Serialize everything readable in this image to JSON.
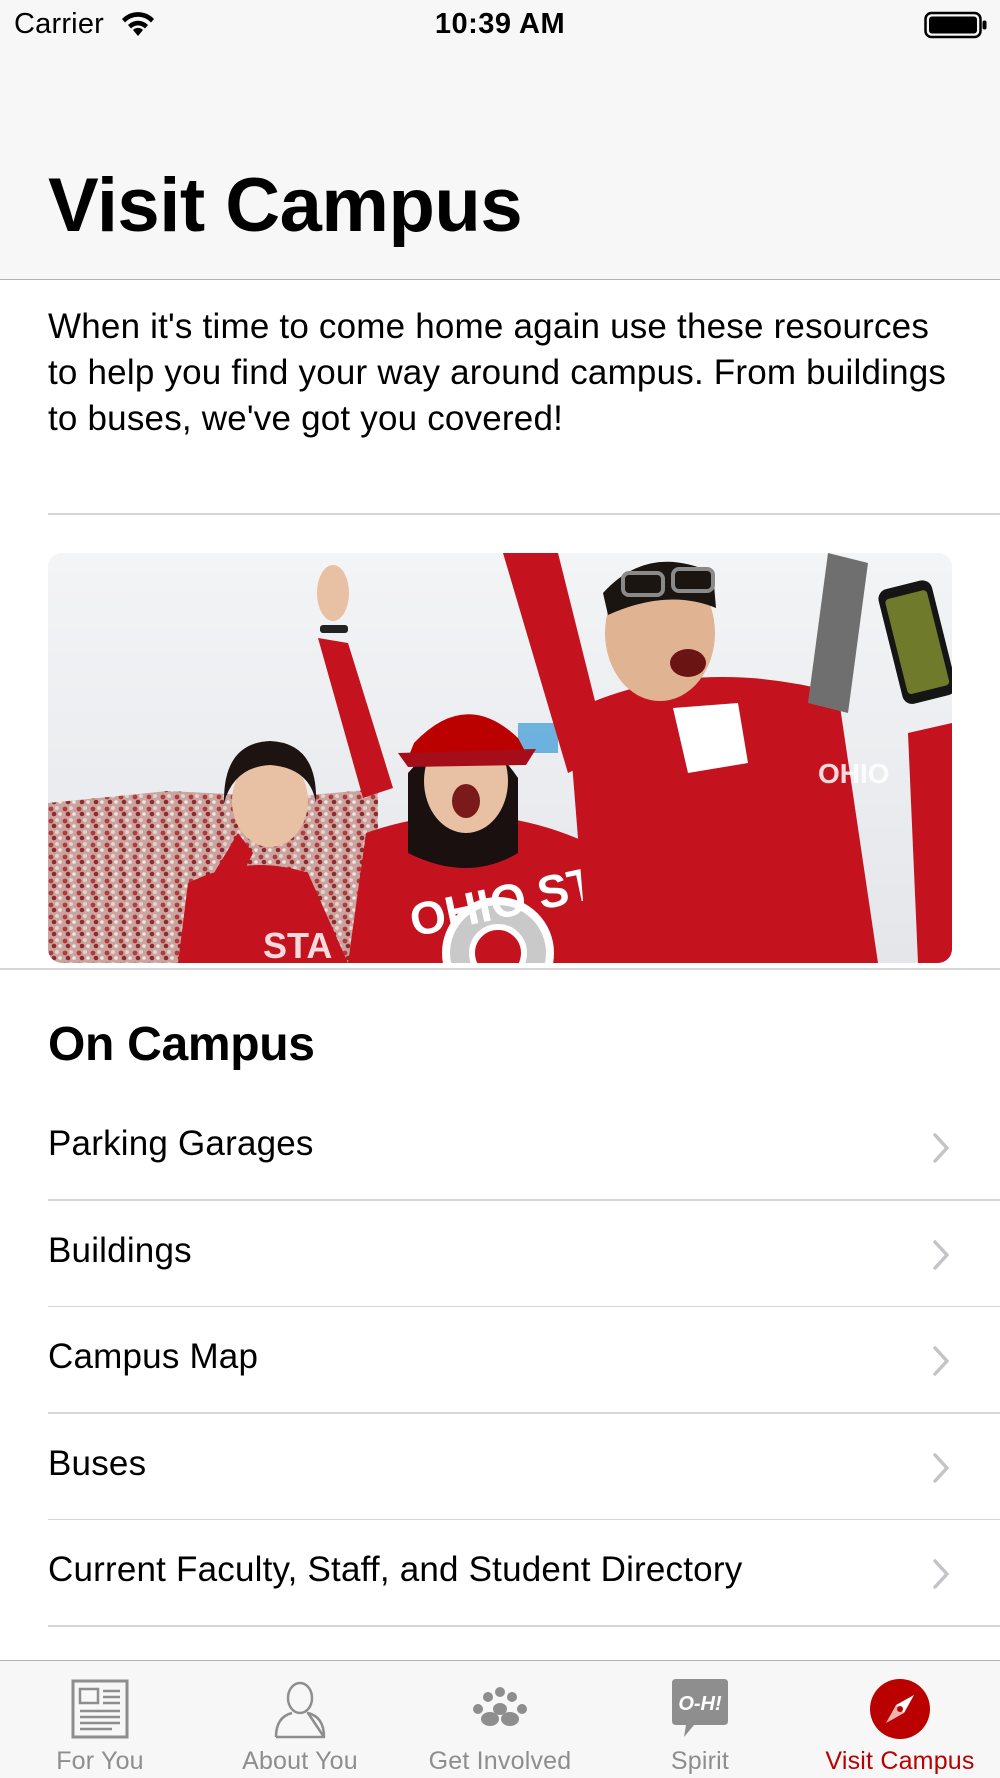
{
  "status_bar": {
    "carrier": "Carrier",
    "time": "10:39 AM"
  },
  "header": {
    "title": "Visit Campus"
  },
  "intro": {
    "text": "When it's time to come home again use these resources to help you find your way around campus. From buildings to buses, we've got you covered!"
  },
  "section": {
    "title": "On Campus"
  },
  "list": {
    "items": [
      {
        "label": "Parking Garages"
      },
      {
        "label": "Buildings"
      },
      {
        "label": "Campus Map"
      },
      {
        "label": "Buses"
      },
      {
        "label": "Current Faculty, Staff, and Student Directory"
      }
    ]
  },
  "tabs": [
    {
      "label": "For You",
      "icon": "newspaper-icon"
    },
    {
      "label": "About You",
      "icon": "person-icon"
    },
    {
      "label": "Get Involved",
      "icon": "paw-prints-icon"
    },
    {
      "label": "Spirit",
      "icon": "oh-speech-bubble-icon",
      "icon_text": "O-H!"
    },
    {
      "label": "Visit Campus",
      "icon": "compass-icon",
      "active": true
    }
  ],
  "colors": {
    "accent": "#bb0000",
    "inactive": "#8e8e8e",
    "bar_background": "#f7f7f7"
  }
}
